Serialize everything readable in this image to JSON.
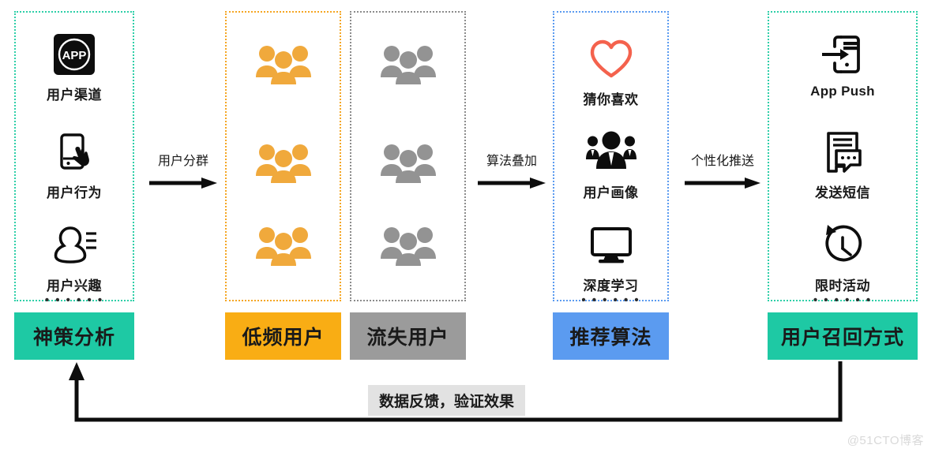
{
  "diagram": {
    "title": "用户召回流程图",
    "columns": [
      {
        "id": "analysis",
        "label": "神策分析",
        "label_color": "#1ec9a4",
        "border_color": "#2ecfa8",
        "items": [
          {
            "icon": "app-badge-icon",
            "caption": "用户渠道"
          },
          {
            "icon": "phone-tap-icon",
            "caption": "用户行为"
          },
          {
            "icon": "user-profile-lines-icon",
            "caption": "用户兴趣"
          }
        ],
        "ellipsis": "• • • • • •"
      },
      {
        "id": "low-frequency-users",
        "label": "低频用户",
        "label_color": "#f9ad14",
        "border_color": "#f5a623",
        "items": [
          {
            "icon": "people-group-icon",
            "caption": ""
          },
          {
            "icon": "people-group-icon",
            "caption": ""
          },
          {
            "icon": "people-group-icon",
            "caption": ""
          }
        ],
        "ellipsis": ""
      },
      {
        "id": "churned-users",
        "label": "流失用户",
        "label_color": "#9b9b9b",
        "border_color": "#8c8c8c",
        "items": [
          {
            "icon": "people-group-icon",
            "caption": ""
          },
          {
            "icon": "people-group-icon",
            "caption": ""
          },
          {
            "icon": "people-group-icon",
            "caption": ""
          }
        ],
        "ellipsis": ""
      },
      {
        "id": "recommend-algorithm",
        "label": "推荐算法",
        "label_color": "#5b9bf0",
        "border_color": "#5b9bf0",
        "items": [
          {
            "icon": "heart-icon",
            "caption": "猜你喜欢"
          },
          {
            "icon": "user-persona-icon",
            "caption": "用户画像"
          },
          {
            "icon": "monitor-icon",
            "caption": "深度学习"
          }
        ],
        "ellipsis": "• • • • • •"
      },
      {
        "id": "recall-channels",
        "label": "用户召回方式",
        "label_color": "#1ec9a4",
        "border_color": "#2ecfa8",
        "items": [
          {
            "icon": "app-push-icon",
            "caption": "App Push"
          },
          {
            "icon": "sms-message-icon",
            "caption": "发送短信"
          },
          {
            "icon": "clock-countdown-icon",
            "caption": "限时活动"
          }
        ],
        "ellipsis": "• • • • • •"
      }
    ],
    "arrows": [
      {
        "id": "arrow-segmentation",
        "label": "用户分群"
      },
      {
        "id": "arrow-algorithm-stack",
        "label": "算法叠加"
      },
      {
        "id": "arrow-personalized-push",
        "label": "个性化推送"
      }
    ],
    "feedback": {
      "label": "数据反馈，验证效果",
      "badge_background": "#e2e2e2"
    },
    "watermark": "@51CTO博客"
  }
}
